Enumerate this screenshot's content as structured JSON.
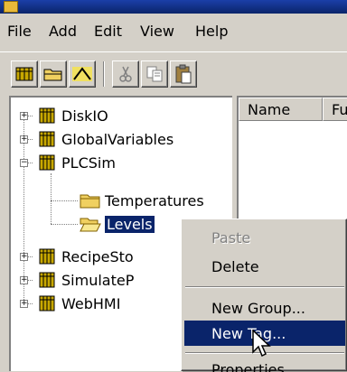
{
  "menubar": {
    "items": [
      "File",
      "Add",
      "Edit",
      "View",
      "Help"
    ]
  },
  "toolbar": {
    "buttons": [
      "add-tag-group-icon",
      "open-folder-icon",
      "wave-icon",
      "cut-icon",
      "copy-icon",
      "paste-icon"
    ]
  },
  "tree": {
    "items": [
      {
        "label": "DiskIO",
        "icon": "database-icon",
        "expander": "+"
      },
      {
        "label": "GlobalVariables",
        "icon": "database-icon",
        "expander": "+"
      },
      {
        "label": "PLCSim",
        "icon": "database-icon",
        "expander": "-"
      },
      {
        "label": "Temperatures",
        "icon": "folder-icon"
      },
      {
        "label": "Levels",
        "icon": "open-folder-icon",
        "selected": true
      },
      {
        "label": "RecipeSto",
        "icon": "database-icon",
        "expander": "+"
      },
      {
        "label": "SimulateP",
        "icon": "database-icon",
        "expander": "+"
      },
      {
        "label": "WebHMI",
        "icon": "database-icon",
        "expander": "+"
      }
    ]
  },
  "list": {
    "columns": [
      "Name",
      "Fu"
    ]
  },
  "context_menu": {
    "items": [
      {
        "label": "Paste",
        "disabled": true
      },
      {
        "label": "Delete"
      },
      {
        "label": "New Group..."
      },
      {
        "label": "New Tag...",
        "highlighted": true
      },
      {
        "label": "Properties"
      }
    ]
  },
  "colors": {
    "selection": "#0a246a",
    "face": "#d4d0c8",
    "db_icon": "#c8a800"
  }
}
